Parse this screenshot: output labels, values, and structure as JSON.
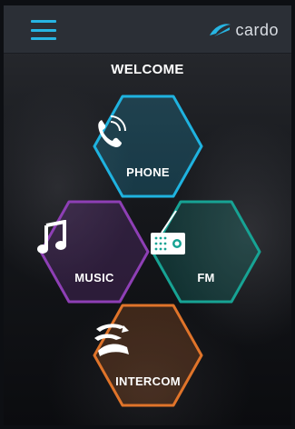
{
  "header": {
    "menu_icon": "hamburger-menu-icon",
    "logo_text": "cardo",
    "logo_icon": "cardo-swoosh-icon"
  },
  "welcome_text": "WELCOME",
  "tiles": [
    {
      "label": "PHONE",
      "icon": "phone-icon",
      "color": "#1fb3e0"
    },
    {
      "label": "MUSIC",
      "icon": "music-note-icon",
      "color": "#8e3fb5"
    },
    {
      "label": "FM",
      "icon": "radio-icon",
      "color": "#17a394"
    },
    {
      "label": "INTERCOM",
      "icon": "intercom-icon",
      "color": "#e0742a"
    }
  ],
  "colors": {
    "accent": "#27b5e3",
    "topbar": "#2b2f36"
  }
}
